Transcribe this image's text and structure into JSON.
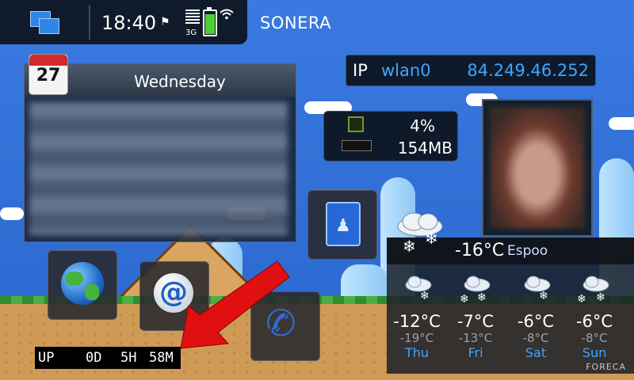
{
  "statusbar": {
    "time": "18:40",
    "network_type": "3G",
    "operator": "SONERA",
    "icons": [
      "task-switcher-icon",
      "new-message-icon",
      "signal-icon",
      "battery-icon",
      "wifi-icon"
    ]
  },
  "calendar": {
    "day_number": "27",
    "weekday": "Wednesday"
  },
  "ip_widget": {
    "label": "IP",
    "interface": "wlan0",
    "address": "84.249.46.252"
  },
  "system_widget": {
    "cpu": "4%",
    "ram": "154MB"
  },
  "shortcuts": {
    "icons": [
      "contacts-icon",
      "web-browser-icon",
      "email-icon",
      "phone-icon"
    ]
  },
  "uptime": {
    "label": "UP",
    "days": "0D",
    "hours": "5H",
    "minutes": "58M"
  },
  "weather": {
    "current_temp": "-16°C",
    "location": "Espoo",
    "forecast": [
      {
        "day": "Thu",
        "high": "-12°C",
        "low": "-19°C"
      },
      {
        "day": "Fri",
        "high": "-7°C",
        "low": "-13°C"
      },
      {
        "day": "Sat",
        "high": "-6°C",
        "low": "-8°C"
      },
      {
        "day": "Sun",
        "high": "-6°C",
        "low": "-8°C"
      }
    ],
    "provider": "FORECA"
  },
  "colors": {
    "accent": "#40a6ff",
    "battery": "#4cd033",
    "arrow": "#e01010"
  }
}
